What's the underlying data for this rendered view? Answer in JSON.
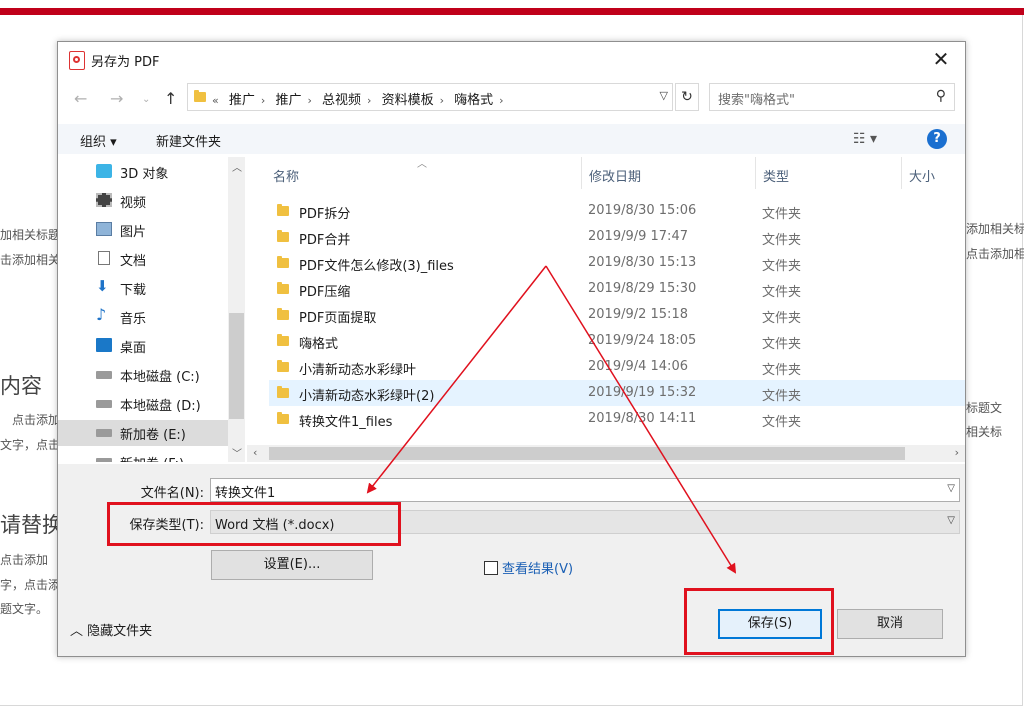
{
  "background": {
    "texts": [
      "加相关标题",
      "击添加相关",
      "内容",
      "点击添加",
      "文字，点击",
      "请替换",
      "点击添加",
      "字，点击添",
      "题文字。",
      "添加相关标",
      "点击添加相",
      "标题文",
      "相关标"
    ]
  },
  "dialog": {
    "title": "另存为 PDF",
    "close_symbol": "✕",
    "address": {
      "prefix": "«",
      "crumbs": [
        "推广",
        "推广",
        "总视频",
        "资料模板",
        "嗨格式"
      ],
      "separator": "›"
    },
    "search_placeholder": "搜索\"嗨格式\"",
    "toolbar": {
      "organize": "组织 ▾",
      "new_folder": "新建文件夹"
    },
    "nav_items": [
      {
        "label": "3D 对象",
        "icon": "cube-icon"
      },
      {
        "label": "视频",
        "icon": "film-icon"
      },
      {
        "label": "图片",
        "icon": "picture-icon"
      },
      {
        "label": "文档",
        "icon": "document-icon"
      },
      {
        "label": "下载",
        "icon": "download-icon"
      },
      {
        "label": "音乐",
        "icon": "music-icon"
      },
      {
        "label": "桌面",
        "icon": "desktop-icon"
      },
      {
        "label": "本地磁盘 (C:)",
        "icon": "drive-icon"
      },
      {
        "label": "本地磁盘 (D:)",
        "icon": "drive-icon"
      },
      {
        "label": "新加卷 (E:)",
        "icon": "drive-icon"
      },
      {
        "label": "新加卷 (F:)",
        "icon": "drive-icon"
      }
    ],
    "columns": {
      "name": "名称",
      "date": "修改日期",
      "type": "类型",
      "size": "大小"
    },
    "files": [
      {
        "name": "PDF拆分",
        "date": "2019/8/30 15:06",
        "type": "文件夹"
      },
      {
        "name": "PDF合并",
        "date": "2019/9/9 17:47",
        "type": "文件夹"
      },
      {
        "name": "PDF文件怎么修改(3)_files",
        "date": "2019/8/30 15:13",
        "type": "文件夹"
      },
      {
        "name": "PDF压缩",
        "date": "2019/8/29 15:30",
        "type": "文件夹"
      },
      {
        "name": "PDF页面提取",
        "date": "2019/9/2 15:18",
        "type": "文件夹"
      },
      {
        "name": "嗨格式",
        "date": "2019/9/24 18:05",
        "type": "文件夹"
      },
      {
        "name": "小清新动态水彩绿叶",
        "date": "2019/9/4 14:06",
        "type": "文件夹"
      },
      {
        "name": "小清新动态水彩绿叶(2)",
        "date": "2019/9/19 15:32",
        "type": "文件夹"
      },
      {
        "name": "转换文件1_files",
        "date": "2019/8/30 14:11",
        "type": "文件夹"
      }
    ],
    "filename_label": "文件名(N):",
    "filename_value": "转换文件1",
    "filetype_label": "保存类型(T):",
    "filetype_value": "Word 文档 (*.docx)",
    "settings_button": "设置(E)...",
    "view_result_label": "查看结果(V)",
    "save_button": "保存(S)",
    "cancel_button": "取消",
    "hide_folders": "隐藏文件夹",
    "accent_color": "#0078d7",
    "annotation_color": "#e0111e"
  }
}
